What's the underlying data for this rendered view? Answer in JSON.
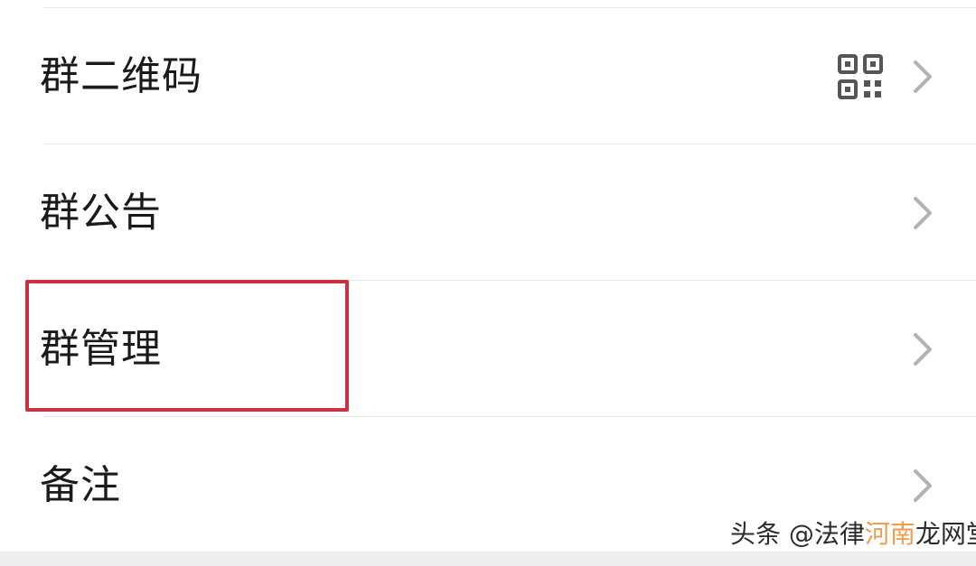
{
  "menu": {
    "items": [
      {
        "label": "群二维码",
        "has_qr": true
      },
      {
        "label": "群公告",
        "has_qr": false
      },
      {
        "label": "群管理",
        "has_qr": false,
        "highlighted": true
      },
      {
        "label": "备注",
        "has_qr": false
      }
    ]
  },
  "icons": {
    "qr": "qr-code-icon",
    "chevron": "chevron-right-icon"
  },
  "colors": {
    "highlight_border": "#c9323e",
    "divider": "#e6e6e6",
    "chevron": "#b2b2b2",
    "text": "#1a1a1a"
  },
  "watermark": {
    "prefix": "头条 @法律",
    "overlay": "河南",
    "suffix": "龙网堂"
  }
}
